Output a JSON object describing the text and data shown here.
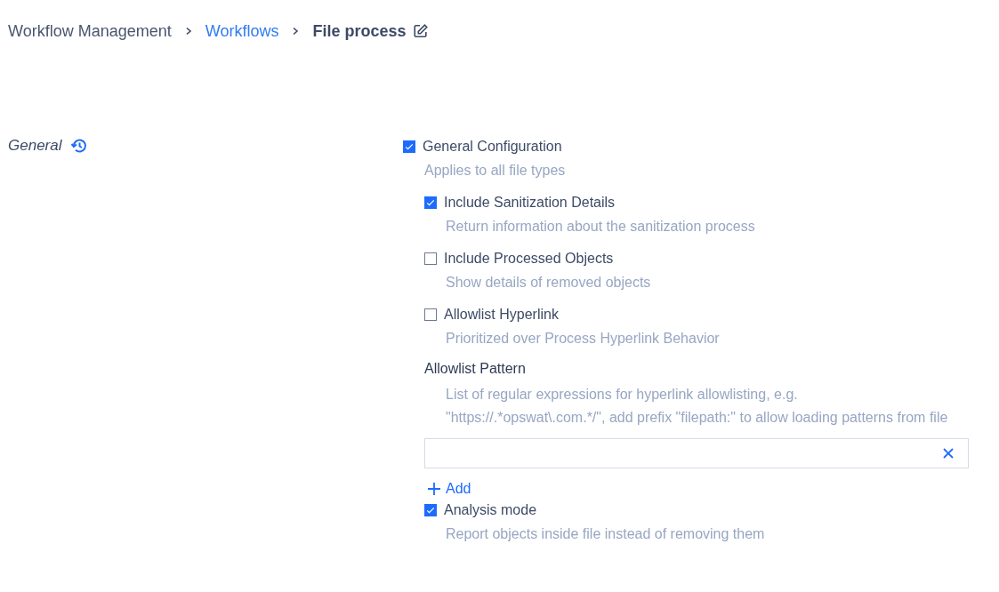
{
  "breadcrumb": [
    {
      "label": "Workflow Management",
      "kind": "plain"
    },
    {
      "label": "Workflows",
      "kind": "link"
    },
    {
      "label": "File process",
      "kind": "current"
    }
  ],
  "section": {
    "title": "General",
    "main": {
      "label": "General Configuration",
      "description": "Applies to all file types",
      "checked": true
    },
    "options": [
      {
        "kind": "checkbox",
        "label": "Include Sanitization Details",
        "description": "Return information about the sanitization process",
        "checked": true
      },
      {
        "kind": "checkbox",
        "label": "Include Processed Objects",
        "description": "Show details of removed objects",
        "checked": false
      },
      {
        "kind": "checkbox",
        "label": "Allowlist Hyperlink",
        "description": "Prioritized over Process Hyperlink Behavior",
        "checked": false
      },
      {
        "kind": "pattern",
        "label": "Allowlist Pattern",
        "description": "List of regular expressions for hyperlink allowlisting, e.g. \"https://.*opswat\\.com.*/\", add prefix \"filepath:\" to allow loading patterns from file",
        "add_label": "Add"
      },
      {
        "kind": "checkbox",
        "label": "Analysis mode",
        "description": "Report objects inside file instead of removing them",
        "checked": true
      }
    ]
  }
}
